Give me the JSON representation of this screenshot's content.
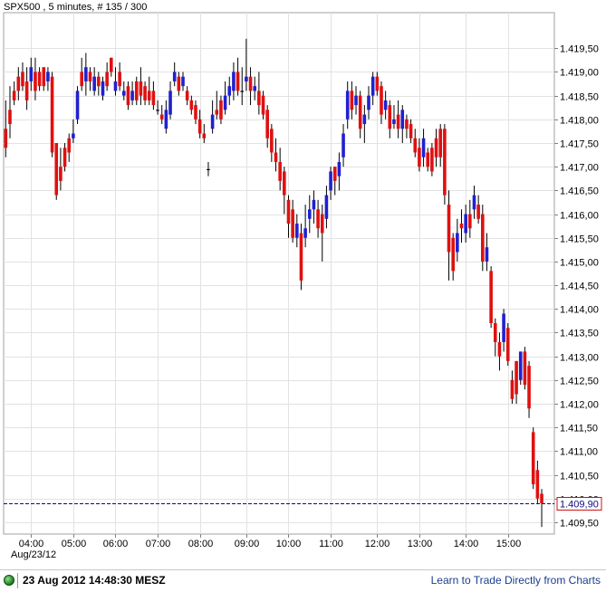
{
  "chart_data": {
    "type": "ohlc-bar",
    "title": "SPX500 , 5 minutes, # 135 / 300",
    "symbol": "SPX500",
    "interval": "5 minutes",
    "bar_count_label": "# 135 / 300",
    "y_axis": {
      "side": "right",
      "range": [
        1409.25,
        1420.25
      ],
      "tick_labels": [
        "1.409,50",
        "1.410,00",
        "1.410,50",
        "1.411,00",
        "1.411,50",
        "1.412,00",
        "1.412,50",
        "1.413,00",
        "1.413,50",
        "1.414,00",
        "1.414,50",
        "1.415,00",
        "1.415,50",
        "1.416,00",
        "1.416,50",
        "1.417,00",
        "1.417,50",
        "1.418,00",
        "1.418,50",
        "1.419,00",
        "1.419,50"
      ],
      "tick_values": [
        1409.5,
        1410.0,
        1410.5,
        1411.0,
        1411.5,
        1412.0,
        1412.5,
        1413.0,
        1413.5,
        1414.0,
        1414.5,
        1415.0,
        1415.5,
        1416.0,
        1416.5,
        1417.0,
        1417.5,
        1418.0,
        1418.5,
        1419.0,
        1419.5
      ]
    },
    "x_axis": {
      "date_label": "Aug/23/12",
      "tick_labels": [
        "04:00",
        "05:00",
        "06:00",
        "07:00",
        "08:00",
        "09:00",
        "10:00",
        "11:00",
        "12:00",
        "13:00",
        "14:00",
        "15:00"
      ],
      "tick_bar_index": [
        6,
        16,
        26,
        36,
        46,
        57,
        67,
        77,
        88,
        98,
        109,
        119
      ],
      "range_bars": [
        -0.5,
        130
      ]
    },
    "grid": true,
    "current_price": {
      "value": 1409.9,
      "label": "1.409,90",
      "color": "#0a0a80"
    },
    "up_color": "#2020d0",
    "down_color": "#e01010",
    "flat_color": "#000000",
    "bars": [
      [
        1417.8,
        1417.4,
        1418.4,
        1417.2
      ],
      [
        1418.2,
        1417.9,
        1418.7,
        1417.6
      ],
      [
        1418.6,
        1418.4,
        1418.8,
        1418.3
      ],
      [
        1418.9,
        1418.6,
        1419.1,
        1418.4
      ],
      [
        1419.0,
        1418.7,
        1419.2,
        1418.6
      ],
      [
        1418.8,
        1418.4,
        1419.1,
        1418.2
      ],
      [
        1418.8,
        1419.1,
        1419.3,
        1418.6
      ],
      [
        1419.0,
        1418.6,
        1419.3,
        1418.4
      ],
      [
        1419.0,
        1418.7,
        1419.1,
        1418.6
      ],
      [
        1419.1,
        1418.7,
        1419.1,
        1418.6
      ],
      [
        1418.8,
        1419.0,
        1419.1,
        1418.6
      ],
      [
        1418.9,
        1417.3,
        1419.0,
        1417.2
      ],
      [
        1417.5,
        1416.4,
        1417.5,
        1416.3
      ],
      [
        1417.0,
        1416.7,
        1417.4,
        1416.5
      ],
      [
        1417.4,
        1417.0,
        1417.5,
        1416.9
      ],
      [
        1417.6,
        1417.3,
        1417.7,
        1417.1
      ],
      [
        1417.6,
        1417.7,
        1418.0,
        1417.5
      ],
      [
        1418.0,
        1418.6,
        1418.7,
        1417.9
      ],
      [
        1419.0,
        1418.7,
        1419.3,
        1418.6
      ],
      [
        1418.8,
        1419.1,
        1419.4,
        1418.5
      ],
      [
        1419.0,
        1418.8,
        1419.1,
        1418.6
      ],
      [
        1418.6,
        1418.9,
        1419.1,
        1418.5
      ],
      [
        1418.9,
        1418.7,
        1419.0,
        1418.5
      ],
      [
        1418.5,
        1418.8,
        1418.9,
        1418.4
      ],
      [
        1419.0,
        1418.7,
        1419.2,
        1418.6
      ],
      [
        1419.3,
        1419.0,
        1419.3,
        1418.9
      ],
      [
        1418.6,
        1418.8,
        1419.1,
        1418.5
      ],
      [
        1419.0,
        1418.7,
        1419.2,
        1418.6
      ],
      [
        1418.5,
        1418.6,
        1418.8,
        1418.4
      ],
      [
        1418.7,
        1418.3,
        1418.8,
        1418.2
      ],
      [
        1418.4,
        1418.6,
        1418.8,
        1418.3
      ],
      [
        1418.8,
        1418.4,
        1418.9,
        1418.3
      ],
      [
        1418.8,
        1418.5,
        1419.1,
        1418.3
      ],
      [
        1418.7,
        1418.4,
        1418.8,
        1418.3
      ],
      [
        1418.6,
        1418.4,
        1418.9,
        1418.3
      ],
      [
        1418.6,
        1418.3,
        1418.8,
        1418.2
      ],
      [
        1418.2,
        1418.2,
        1418.4,
        1418.1
      ],
      [
        1418.1,
        1418.0,
        1418.3,
        1417.9
      ],
      [
        1417.8,
        1418.2,
        1418.4,
        1417.7
      ],
      [
        1418.1,
        1418.6,
        1418.8,
        1418.0
      ],
      [
        1418.8,
        1419.0,
        1419.2,
        1418.7
      ],
      [
        1418.9,
        1418.6,
        1419.0,
        1418.5
      ],
      [
        1418.7,
        1418.9,
        1419.0,
        1418.6
      ],
      [
        1418.6,
        1418.4,
        1418.7,
        1418.3
      ],
      [
        1418.4,
        1418.2,
        1418.5,
        1418.1
      ],
      [
        1418.3,
        1418.0,
        1418.4,
        1417.9
      ],
      [
        1418.0,
        1417.7,
        1418.2,
        1417.6
      ],
      [
        1417.7,
        1417.6,
        1417.9,
        1417.5
      ],
      [
        1416.95,
        1416.95,
        1417.1,
        1416.8
      ],
      [
        1417.8,
        1418.1,
        1418.4,
        1417.7
      ],
      [
        1418.2,
        1418.1,
        1418.6,
        1418.0
      ],
      [
        1418.4,
        1418.0,
        1418.5,
        1417.9
      ],
      [
        1418.2,
        1418.5,
        1418.8,
        1418.1
      ],
      [
        1418.5,
        1418.7,
        1418.9,
        1418.3
      ],
      [
        1418.6,
        1419.0,
        1419.2,
        1418.4
      ],
      [
        1419.0,
        1418.6,
        1419.3,
        1418.5
      ],
      [
        1418.6,
        1418.6,
        1419.1,
        1418.3
      ],
      [
        1418.8,
        1418.9,
        1419.7,
        1418.6
      ],
      [
        1418.9,
        1418.6,
        1419.1,
        1418.3
      ],
      [
        1418.6,
        1418.7,
        1418.9,
        1418.4
      ],
      [
        1418.6,
        1418.3,
        1419.0,
        1418.1
      ],
      [
        1418.5,
        1418.1,
        1418.6,
        1418.0
      ],
      [
        1418.2,
        1417.6,
        1418.3,
        1417.4
      ],
      [
        1417.8,
        1417.3,
        1417.9,
        1417.1
      ],
      [
        1417.3,
        1417.1,
        1417.6,
        1416.9
      ],
      [
        1417.1,
        1416.7,
        1417.4,
        1416.5
      ],
      [
        1416.9,
        1416.4,
        1417.0,
        1416.0
      ],
      [
        1416.3,
        1415.8,
        1416.4,
        1415.5
      ],
      [
        1416.1,
        1415.5,
        1416.3,
        1415.4
      ],
      [
        1415.5,
        1415.8,
        1416.0,
        1415.3
      ],
      [
        1415.6,
        1414.6,
        1415.8,
        1414.4
      ],
      [
        1415.5,
        1415.7,
        1416.2,
        1415.3
      ],
      [
        1415.9,
        1416.1,
        1416.4,
        1415.6
      ],
      [
        1416.1,
        1416.3,
        1416.5,
        1415.8
      ],
      [
        1416.1,
        1415.7,
        1416.3,
        1415.5
      ],
      [
        1416.0,
        1415.6,
        1416.2,
        1415.0
      ],
      [
        1415.9,
        1416.4,
        1416.6,
        1415.7
      ],
      [
        1416.5,
        1416.9,
        1417.0,
        1416.3
      ],
      [
        1417.0,
        1416.7,
        1417.0,
        1416.4
      ],
      [
        1416.8,
        1417.1,
        1417.3,
        1416.5
      ],
      [
        1417.2,
        1417.7,
        1417.9,
        1417.0
      ],
      [
        1418.0,
        1418.6,
        1418.8,
        1417.8
      ],
      [
        1418.6,
        1418.2,
        1418.8,
        1418.0
      ],
      [
        1418.3,
        1418.5,
        1418.7,
        1418.1
      ],
      [
        1418.5,
        1417.8,
        1418.6,
        1417.6
      ],
      [
        1417.9,
        1418.1,
        1418.3,
        1417.5
      ],
      [
        1418.2,
        1418.5,
        1418.7,
        1418.0
      ],
      [
        1418.5,
        1418.9,
        1419.0,
        1418.3
      ],
      [
        1418.9,
        1418.6,
        1419.0,
        1418.5
      ],
      [
        1418.7,
        1418.1,
        1418.8,
        1417.9
      ],
      [
        1418.2,
        1418.4,
        1418.6,
        1418.0
      ],
      [
        1418.3,
        1417.8,
        1418.4,
        1417.6
      ],
      [
        1417.9,
        1418.0,
        1418.3,
        1417.8
      ],
      [
        1418.1,
        1417.8,
        1418.4,
        1417.6
      ],
      [
        1417.8,
        1418.2,
        1418.3,
        1417.5
      ],
      [
        1418.0,
        1417.8,
        1418.1,
        1417.6
      ],
      [
        1417.9,
        1417.6,
        1418.0,
        1417.5
      ],
      [
        1417.6,
        1417.3,
        1417.8,
        1417.2
      ],
      [
        1417.4,
        1417.0,
        1417.6,
        1416.9
      ],
      [
        1417.2,
        1417.6,
        1417.8,
        1417.0
      ],
      [
        1417.3,
        1417.0,
        1417.4,
        1416.9
      ],
      [
        1417.4,
        1416.9,
        1417.5,
        1416.8
      ],
      [
        1417.6,
        1417.2,
        1417.8,
        1417.0
      ],
      [
        1417.8,
        1417.2,
        1417.9,
        1417.0
      ],
      [
        1417.8,
        1416.4,
        1417.9,
        1416.2
      ],
      [
        1416.2,
        1415.2,
        1416.5,
        1414.6
      ],
      [
        1415.5,
        1414.8,
        1415.6,
        1414.6
      ],
      [
        1415.2,
        1415.6,
        1415.9,
        1415.0
      ],
      [
        1415.8,
        1415.7,
        1416.1,
        1415.4
      ],
      [
        1415.6,
        1416.0,
        1416.2,
        1415.4
      ],
      [
        1416.0,
        1415.7,
        1416.3,
        1415.5
      ],
      [
        1416.1,
        1416.4,
        1416.6,
        1415.9
      ],
      [
        1416.2,
        1415.9,
        1416.4,
        1415.8
      ],
      [
        1416.0,
        1415.0,
        1416.2,
        1414.8
      ],
      [
        1415.0,
        1415.3,
        1415.6,
        1414.8
      ],
      [
        1414.8,
        1413.7,
        1414.9,
        1413.6
      ],
      [
        1413.7,
        1413.3,
        1413.8,
        1413.0
      ],
      [
        1413.3,
        1413.0,
        1413.5,
        1412.7
      ],
      [
        1413.3,
        1413.9,
        1414.0,
        1413.1
      ],
      [
        1413.6,
        1412.9,
        1413.7,
        1412.8
      ],
      [
        1412.5,
        1412.1,
        1412.7,
        1412.0
      ],
      [
        1412.9,
        1412.2,
        1412.9,
        1412.0
      ],
      [
        1412.5,
        1413.1,
        1413.1,
        1412.4
      ],
      [
        1413.1,
        1412.4,
        1413.2,
        1412.3
      ],
      [
        1412.8,
        1411.9,
        1412.9,
        1411.7
      ],
      [
        1411.4,
        1410.3,
        1411.5,
        1410.2
      ],
      [
        1410.6,
        1410.0,
        1410.8,
        1409.9
      ],
      [
        1410.1,
        1409.9,
        1410.2,
        1409.4
      ]
    ]
  },
  "footer": {
    "timestamp": "23 Aug 2012 14:48:30 MESZ",
    "link_text": "Learn to Trade Directly from Charts"
  }
}
